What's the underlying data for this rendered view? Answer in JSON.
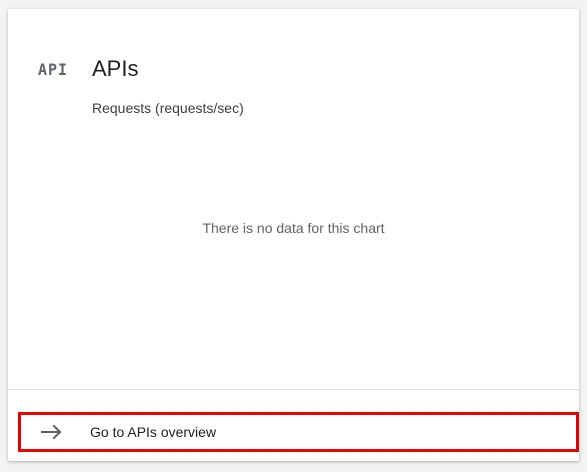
{
  "card": {
    "icon_text": "API",
    "title": "APIs",
    "subtitle": "Requests (requests/sec)"
  },
  "chart": {
    "empty_message": "There is no data for this chart"
  },
  "footer": {
    "link_icon": "arrow-forward-icon",
    "link_label": "Go to APIs overview"
  }
}
